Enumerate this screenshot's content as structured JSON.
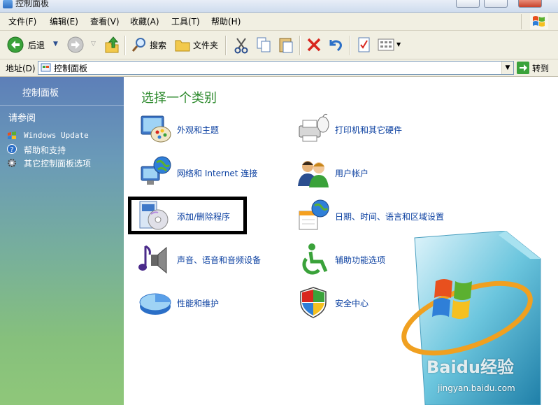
{
  "window": {
    "title": "控制面板"
  },
  "menubar": {
    "items": [
      "文件(F)",
      "编辑(E)",
      "查看(V)",
      "收藏(A)",
      "工具(T)",
      "帮助(H)"
    ]
  },
  "toolbar": {
    "back_label": "后退",
    "search_label": "搜索",
    "folders_label": "文件夹"
  },
  "addressbar": {
    "label": "地址(D)",
    "value": "控制面板",
    "go_label": "转到"
  },
  "sidebar": {
    "title": "控制面板",
    "see_also": "请参阅",
    "links": [
      "Windows Update",
      "帮助和支持",
      "其它控制面板选项"
    ]
  },
  "main": {
    "heading": "选择一个类别",
    "categories": [
      "外观和主题",
      "打印机和其它硬件",
      "网络和 Internet 连接",
      "用户帐户",
      "添加/删除程序",
      "日期、时间、语言和区域设置",
      "声音、语音和音频设备",
      "辅助功能选项",
      "性能和维护",
      "安全中心"
    ]
  },
  "watermark": {
    "text": "Baidu经验",
    "sub": "jingyan.baidu.com"
  },
  "colors": {
    "heading": "#2d8a2d",
    "link": "#0a3fa0",
    "highlight": "#000000"
  }
}
